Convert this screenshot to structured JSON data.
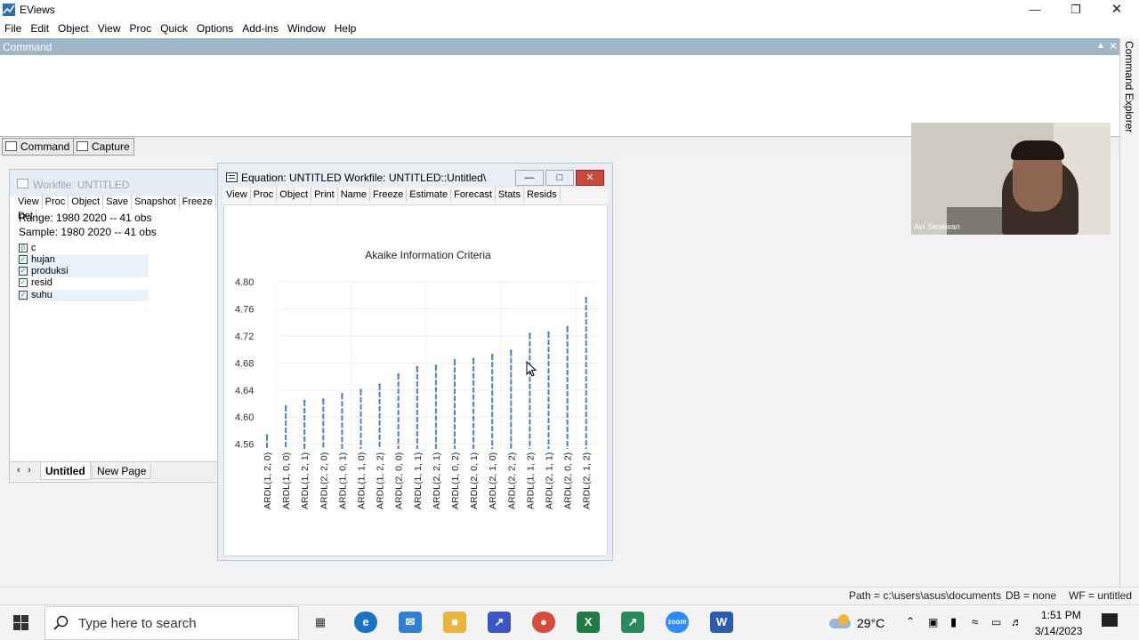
{
  "app": {
    "title": "EViews"
  },
  "menu": [
    "File",
    "Edit",
    "Object",
    "View",
    "Proc",
    "Quick",
    "Options",
    "Add-ins",
    "Window",
    "Help"
  ],
  "command": {
    "title": "Command",
    "tabs": [
      "Command",
      "Capture"
    ],
    "side_label": "Command Explorer"
  },
  "workfile": {
    "title": "Workfile: UNTITLED",
    "toolbar": [
      "View",
      "Proc",
      "Object",
      "Save",
      "Snapshot",
      "Freeze",
      "Det"
    ],
    "range": "Range:  1980 2020   --   41 obs",
    "sample": "Sample: 1980 2020   --   41 obs",
    "objects": [
      {
        "name": "c",
        "type": "coef"
      },
      {
        "name": "hujan",
        "type": "series"
      },
      {
        "name": "produksi",
        "type": "series"
      },
      {
        "name": "resid",
        "type": "series"
      },
      {
        "name": "suhu",
        "type": "series"
      }
    ],
    "tabs": [
      "Untitled",
      "New Page"
    ]
  },
  "equation": {
    "title": "Equation: UNTITLED   Workfile: UNTITLED::Untitled\\",
    "toolbar": [
      "View",
      "Proc",
      "Object",
      "Print",
      "Name",
      "Freeze",
      "Estimate",
      "Forecast",
      "Stats",
      "Resids"
    ]
  },
  "chart_data": {
    "type": "bar",
    "title": "Akaike Information Criteria",
    "categories": [
      "ARDL(1, 2, 0)",
      "ARDL(1, 0, 0)",
      "ARDL(1, 2, 1)",
      "ARDL(2, 2, 0)",
      "ARDL(1, 0, 1)",
      "ARDL(1, 1, 0)",
      "ARDL(1, 2, 2)",
      "ARDL(2, 0, 0)",
      "ARDL(1, 1, 1)",
      "ARDL(2, 2, 1)",
      "ARDL(1, 0, 2)",
      "ARDL(2, 0, 1)",
      "ARDL(2, 1, 0)",
      "ARDL(2, 2, 2)",
      "ARDL(1, 1, 2)",
      "ARDL(2, 1, 1)",
      "ARDL(2, 0, 2)",
      "ARDL(2, 1, 2)"
    ],
    "values": [
      4.573,
      4.616,
      4.624,
      4.626,
      4.634,
      4.64,
      4.648,
      4.663,
      4.674,
      4.676,
      4.684,
      4.686,
      4.692,
      4.698,
      4.723,
      4.725,
      4.733,
      4.776
    ],
    "yticks": [
      "4.80",
      "4.76",
      "4.72",
      "4.68",
      "4.64",
      "4.60",
      "4.56"
    ],
    "ylim": [
      4.553,
      4.8
    ],
    "color": "#4a7fc0"
  },
  "webcam": {
    "name": "Avi Setiawan"
  },
  "status": {
    "path": "Path = c:\\users\\asus\\documents",
    "db": "DB = none",
    "wf": "WF = untitled"
  },
  "taskbar": {
    "search_placeholder": "Type here to search",
    "weather": "29°C",
    "time": "1:51 PM",
    "date": "3/14/2023"
  }
}
